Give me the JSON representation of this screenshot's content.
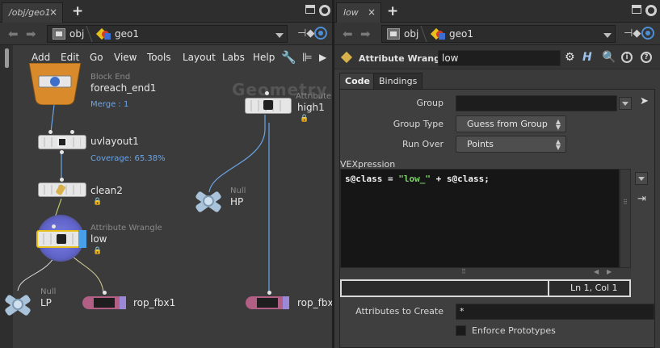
{
  "left": {
    "tab_label": "/obj/geo1",
    "tab_close": "×",
    "tab_add": "+",
    "path": {
      "obj": "obj",
      "geo": "geo1"
    },
    "menu": [
      "Add",
      "Edit",
      "Go",
      "View",
      "Tools",
      "Layout",
      "Labs",
      "Help"
    ],
    "watermark": "Geometry",
    "nodes": {
      "foreach_end": {
        "type": "Block End",
        "name": "foreach_end1",
        "sub": "Merge : 1"
      },
      "uvlayout": {
        "name": "uvlayout1",
        "sub": "Coverage: 65.38%"
      },
      "clean": {
        "name": "clean2"
      },
      "wrangle": {
        "type": "Attribute Wrangle",
        "name": "low"
      },
      "high": {
        "type": "Attribute",
        "name": "high1"
      },
      "hp": {
        "type": "Null",
        "name": "HP"
      },
      "lp": {
        "type": "Null",
        "name": "LP"
      },
      "rop1": {
        "name": "rop_fbx1"
      },
      "rop2": {
        "name": "rop_fbx"
      }
    }
  },
  "right": {
    "tab_label": "low",
    "tab_close": "×",
    "tab_add": "+",
    "path": {
      "obj": "obj",
      "geo": "geo1"
    },
    "node_type": "Attribute Wrangle",
    "node_name": "low",
    "tabs": [
      "Code",
      "Bindings"
    ],
    "params": {
      "group_label": "Group",
      "group_value": "",
      "group_type_label": "Group Type",
      "group_type_value": "Guess from Group",
      "run_over_label": "Run Over",
      "run_over_value": "Points",
      "vex_label": "VEXpression",
      "vex_code_pre": "s@class = ",
      "vex_code_str": "\"low_\"",
      "vex_code_post": " + s@class;",
      "cursor_pos": "Ln 1, Col 1",
      "attrs_label": "Attributes to Create",
      "attrs_value": "*",
      "enforce_label": "Enforce Prototypes"
    }
  },
  "colors": {
    "accent_blue": "#4d8fd6",
    "vex_string": "#7fd36a",
    "rop_pink": "#b25f86",
    "block_orange": "#d98a2a"
  }
}
